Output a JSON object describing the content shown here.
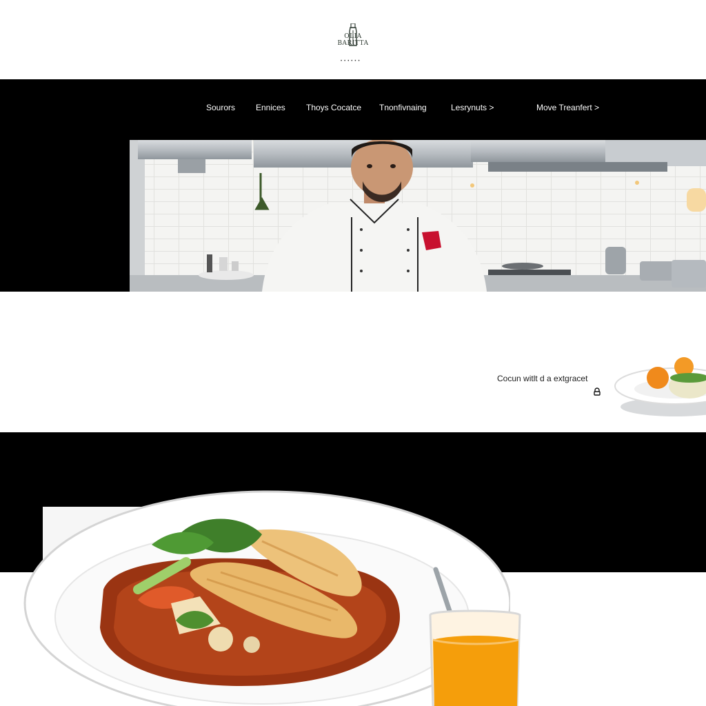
{
  "brand": {
    "logo_text": "OLIA BARITTA",
    "logo_dots": "••••••"
  },
  "nav": {
    "items": [
      {
        "label": "Sourors"
      },
      {
        "label": "Ennices"
      },
      {
        "label": "Thoys Cocatce"
      },
      {
        "label": "Tnonfivnaing"
      },
      {
        "label": "Lesrynuts >"
      },
      {
        "label": "Move Treanfert >"
      }
    ]
  },
  "feature": {
    "caption": "Cocun witlt d a extgracet"
  },
  "colors": {
    "background": "#ffffff",
    "nav_bg": "#000000",
    "nav_text": "#ffffff",
    "sauce": "#9a3412",
    "juice": "#f59e0b"
  }
}
